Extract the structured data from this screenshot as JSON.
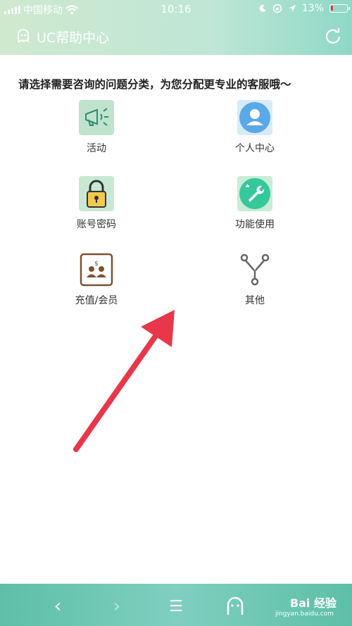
{
  "status_bar": {
    "carrier": "中国移动",
    "time": "10:16",
    "battery_percent": "13%",
    "battery_level": 0.13
  },
  "header": {
    "title": "UC帮助中心"
  },
  "prompt": "请选择需要咨询的问题分类，为您分配更专业的客服哦～",
  "categories": [
    {
      "label": "活动",
      "icon": "megaphone-icon"
    },
    {
      "label": "个人中心",
      "icon": "person-icon"
    },
    {
      "label": "账号密码",
      "icon": "lock-icon"
    },
    {
      "label": "功能使用",
      "icon": "wrench-icon"
    },
    {
      "label": "充值/会员",
      "icon": "members-icon"
    },
    {
      "label": "其他",
      "icon": "branch-icon"
    }
  ],
  "bottom_nav": {
    "back": "‹",
    "forward": "›",
    "menu": "☰"
  },
  "watermark": {
    "brand": "Bai 经验",
    "url": "jingyan.baidu.com"
  },
  "colors": {
    "header_gradient_start": "#cfe9cf",
    "header_gradient_end": "#8fd8c6",
    "bottom_bar": "#5dbfa6",
    "arrow": "#e8374a"
  }
}
